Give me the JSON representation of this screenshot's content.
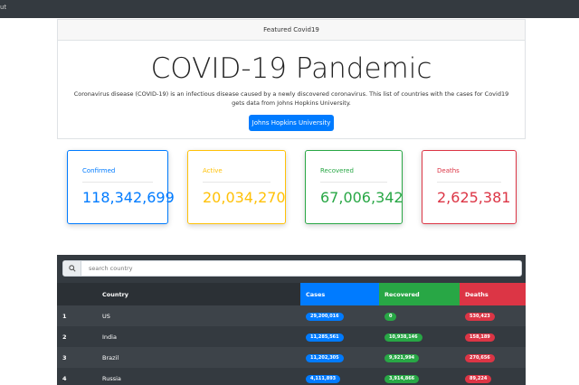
{
  "topbar": {
    "text": "ut"
  },
  "featured": {
    "header": "Featured Covid19",
    "title": "COVID-19 Pandemic",
    "description": "Coronavirus disease (COVID-19) is an infectious disease caused by a newly discovered coronavirus. This list of countries with the cases for Covid19 gets data from Johns Hopkins University.",
    "button_label": "Johns Hopkins University"
  },
  "stats": [
    {
      "label": "Confirmed",
      "value": "118,342,699",
      "color": "#007bff"
    },
    {
      "label": "Active",
      "value": "20,034,270",
      "color": "#ffc107"
    },
    {
      "label": "Recovered",
      "value": "67,006,342",
      "color": "#28a745"
    },
    {
      "label": "Deaths",
      "value": "2,625,381",
      "color": "#dc3545"
    }
  ],
  "search": {
    "placeholder": "search country",
    "icon": "search-icon"
  },
  "table": {
    "headers": {
      "rank": "",
      "country": "Country",
      "cases": "Cases",
      "recovered": "Recovered",
      "deaths": "Deaths"
    },
    "rows": [
      {
        "rank": "1",
        "country": "US",
        "cases": "29,200,016",
        "recovered": "0",
        "deaths": "530,423"
      },
      {
        "rank": "2",
        "country": "India",
        "cases": "11,285,561",
        "recovered": "10,938,146",
        "deaths": "158,189"
      },
      {
        "rank": "3",
        "country": "Brazil",
        "cases": "11,202,305",
        "recovered": "9,921,994",
        "deaths": "270,656"
      },
      {
        "rank": "4",
        "country": "Russia",
        "cases": "4,111,893",
        "recovered": "3,914,866",
        "deaths": "89,224"
      }
    ]
  }
}
